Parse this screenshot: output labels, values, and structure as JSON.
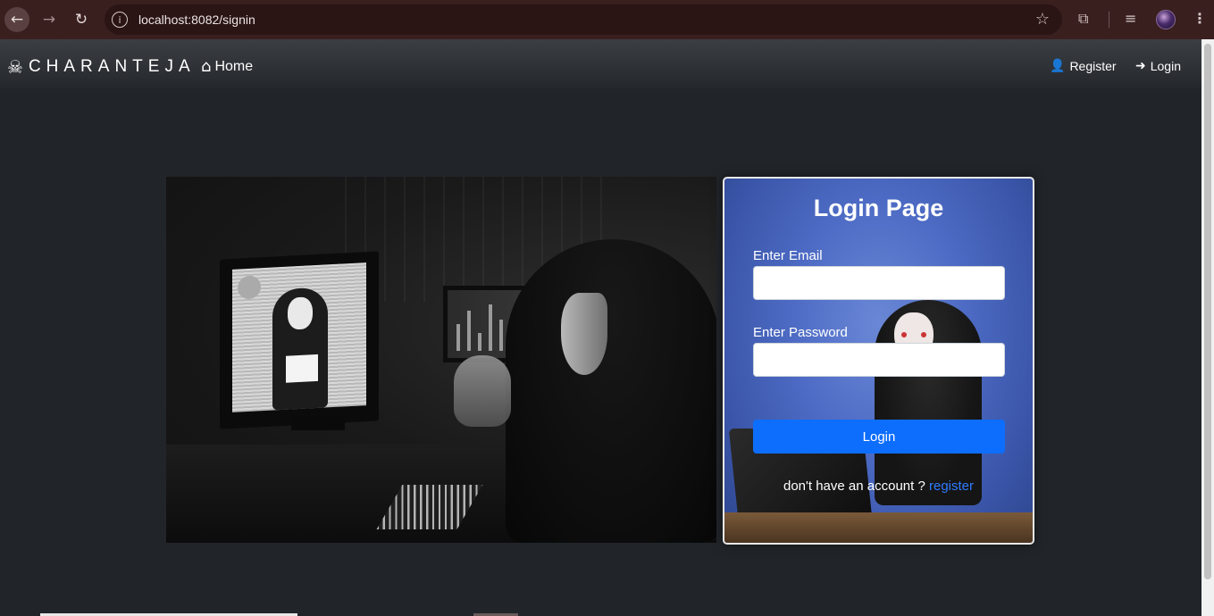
{
  "browser": {
    "url": "localhost:8082/signin"
  },
  "navbar": {
    "brand": "CHARANTEJA",
    "home_label": "Home",
    "register_label": "Register",
    "login_label": "Login"
  },
  "login_card": {
    "title": "Login Page",
    "email_label": "Enter Email",
    "email_value": "",
    "password_label": "Enter Password",
    "password_value": "",
    "login_button": "Login",
    "signup_prompt": "don't have an account ?",
    "signup_link": "register"
  },
  "colors": {
    "page_background": "#212529",
    "primary_button": "#0d6efd",
    "link": "#2f7bff"
  },
  "icons": [
    "back-arrow-icon",
    "forward-arrow-icon",
    "reload-icon",
    "site-info-icon",
    "bookmark-star-icon",
    "extensions-icon",
    "media-control-icon",
    "profile-avatar",
    "kebab-menu-icon",
    "skull-crossbones-icon",
    "home-icon",
    "user-plus-icon",
    "sign-in-icon"
  ]
}
